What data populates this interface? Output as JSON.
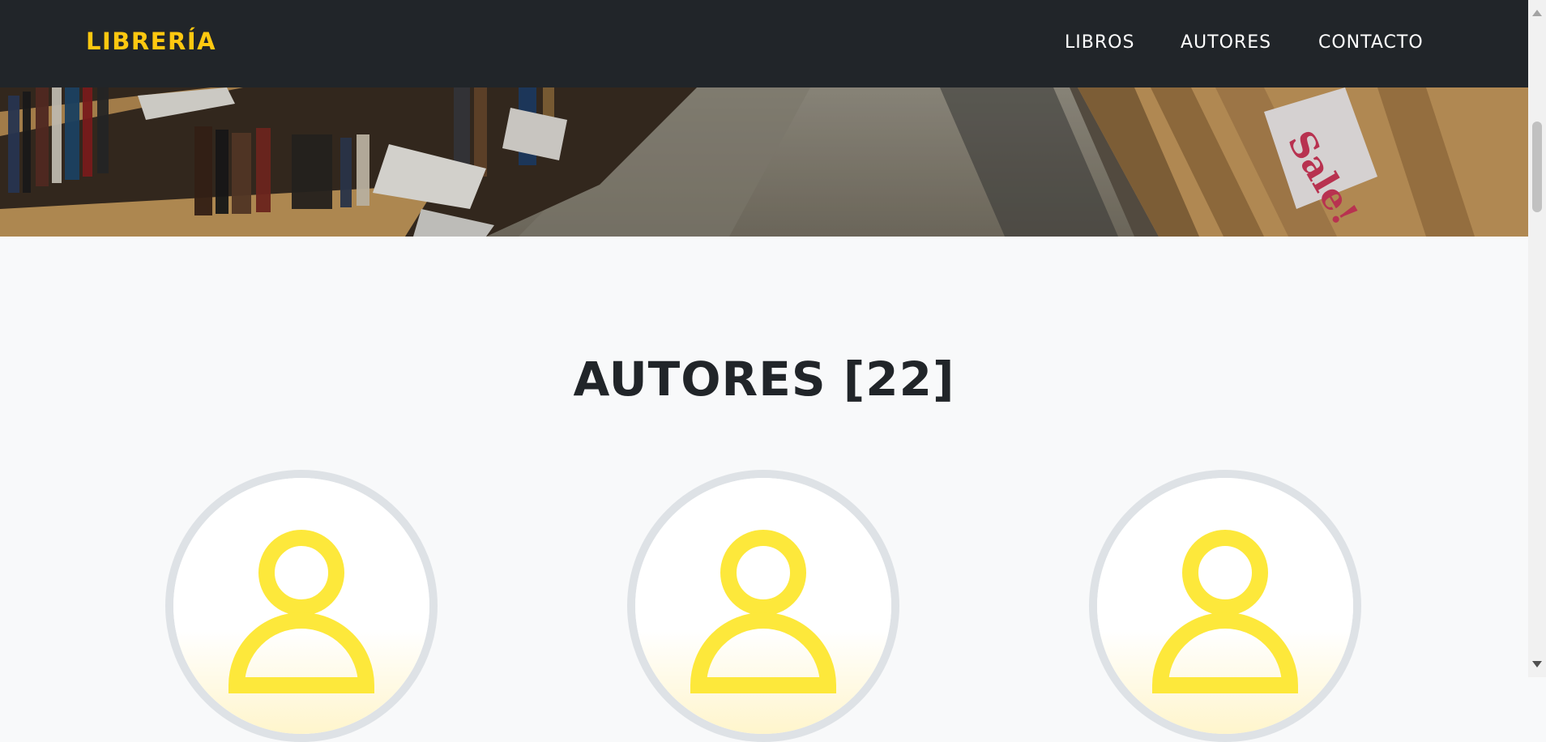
{
  "navbar": {
    "brand": "LIBRERÍA",
    "links": [
      "LIBROS",
      "AUTORES",
      "CONTACTO"
    ]
  },
  "hero": {
    "image": "bookstore-shelves-photo",
    "sign_text": "Sale!"
  },
  "authors_section": {
    "title": "AUTORES [22]",
    "avatars": [
      "user-icon",
      "user-icon",
      "user-icon"
    ]
  },
  "colors": {
    "navbar_bg": "#212529",
    "brand": "#fec810",
    "page_bg": "#f8f9fa",
    "avatar_icon": "#fde83b",
    "avatar_border": "#dee2e6"
  }
}
